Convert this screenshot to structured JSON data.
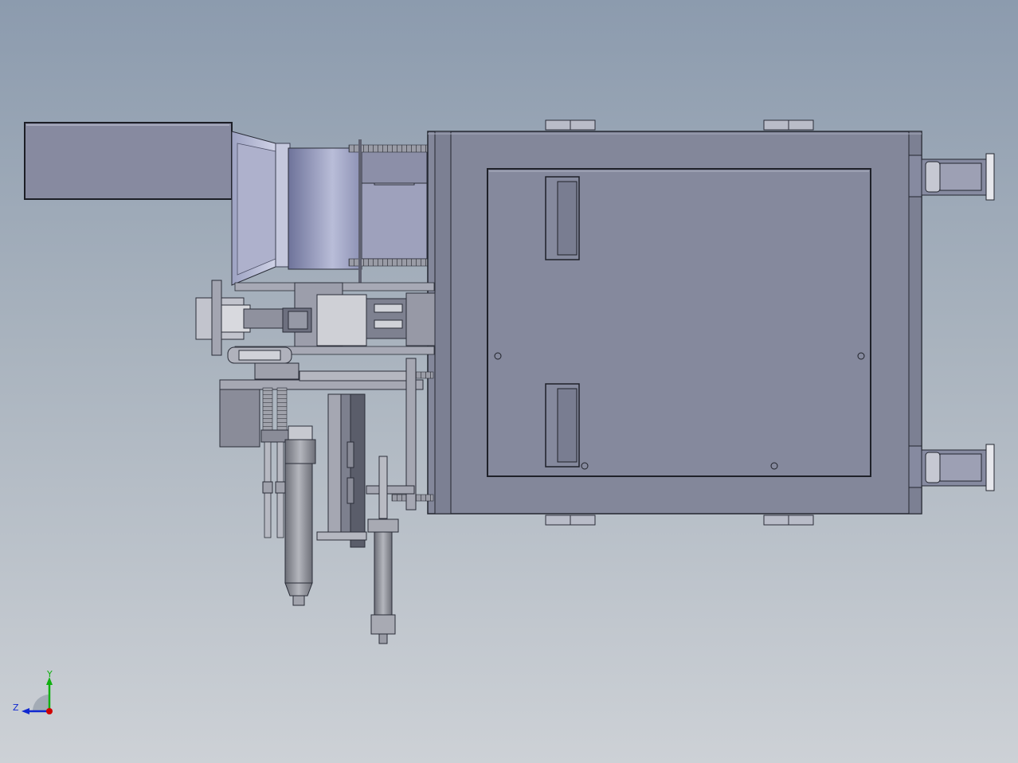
{
  "viewport": {
    "background_top": "#8c9bae",
    "background_bottom": "#cdd1d6"
  },
  "colors": {
    "frame_fill": "#82879a",
    "frame_stroke": "#2a2d38",
    "panel_fill": "#84889b",
    "light_part": "#c4c6cc",
    "mid_part": "#9a9cab",
    "motor_body": "#8a8fa8",
    "axis_x": "#d00000",
    "axis_y": "#10b010",
    "axis_z": "#1028d0"
  },
  "triad": {
    "x_label": "",
    "y_label": "Y",
    "z_label": "Z"
  }
}
